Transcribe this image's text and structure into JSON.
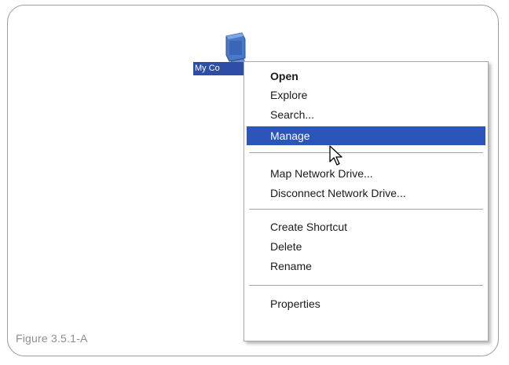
{
  "figure": {
    "caption": "Figure 3.5.1-A"
  },
  "desktop_icon": {
    "icon": "my-computer-icon",
    "label": "My Co"
  },
  "context_menu": {
    "items": [
      {
        "label": "Open",
        "bold": true
      },
      {
        "label": "Explore"
      },
      {
        "label": "Search..."
      },
      {
        "label": "Manage",
        "highlighted": true
      },
      {
        "label": "Map Network Drive..."
      },
      {
        "label": "Disconnect Network Drive..."
      },
      {
        "label": "Create Shortcut"
      },
      {
        "label": "Delete"
      },
      {
        "label": "Rename"
      },
      {
        "label": "Properties"
      }
    ]
  },
  "colors": {
    "highlight": "#2b55b8",
    "icon_label_bg": "#2e4ea6",
    "frame_border": "#9c9c9c",
    "caption_text": "#8e8e8e"
  },
  "cursor": "arrow-cursor-icon"
}
